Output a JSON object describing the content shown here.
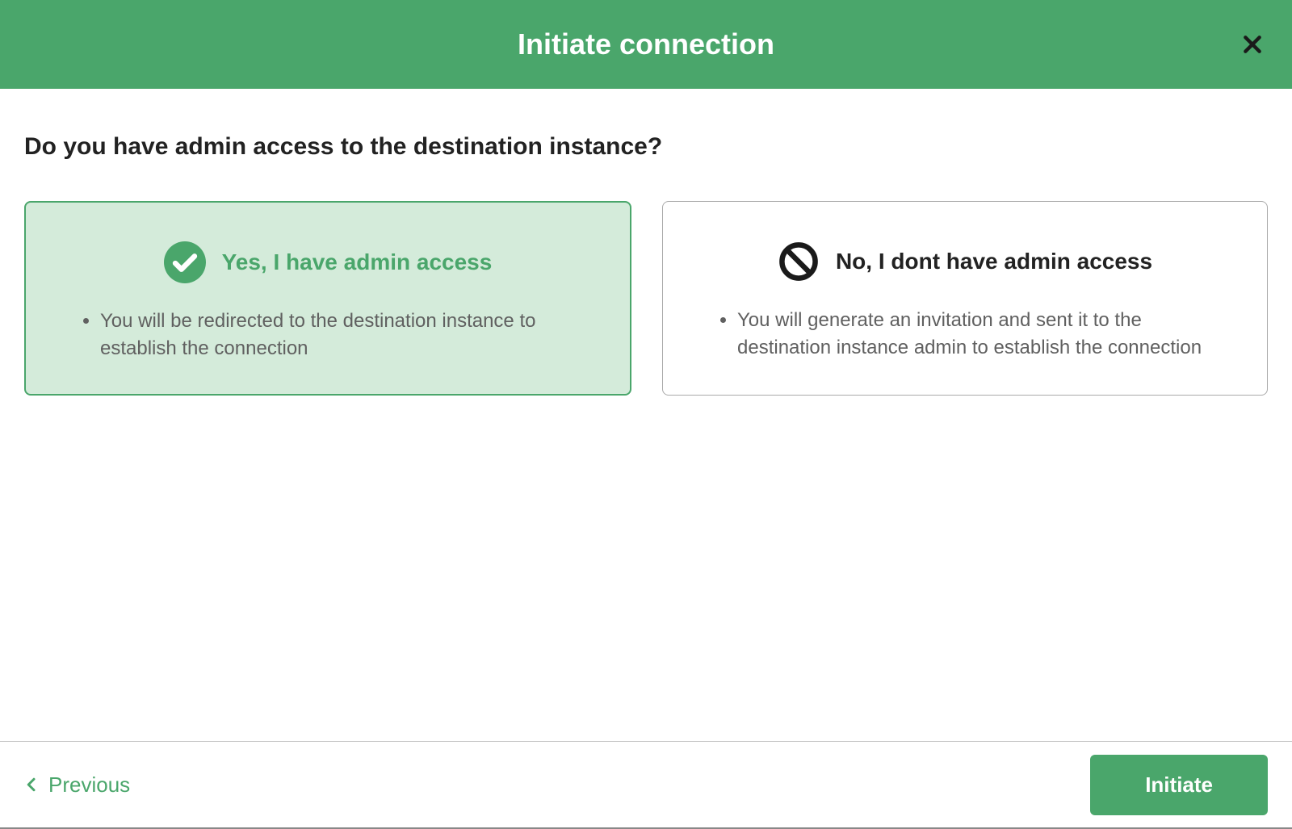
{
  "header": {
    "title": "Initiate connection"
  },
  "question": "Do you have admin access to the destination instance?",
  "options": {
    "yes": {
      "title": "Yes, I have admin access",
      "bullet": "You will be redirected to the destination instance to establish the connection"
    },
    "no": {
      "title": "No, I dont have admin access",
      "bullet": "You will generate an invitation and sent it to the destination instance admin to establish the connection"
    }
  },
  "footer": {
    "previous": "Previous",
    "initiate": "Initiate"
  },
  "colors": {
    "accent": "#4aa66b"
  }
}
